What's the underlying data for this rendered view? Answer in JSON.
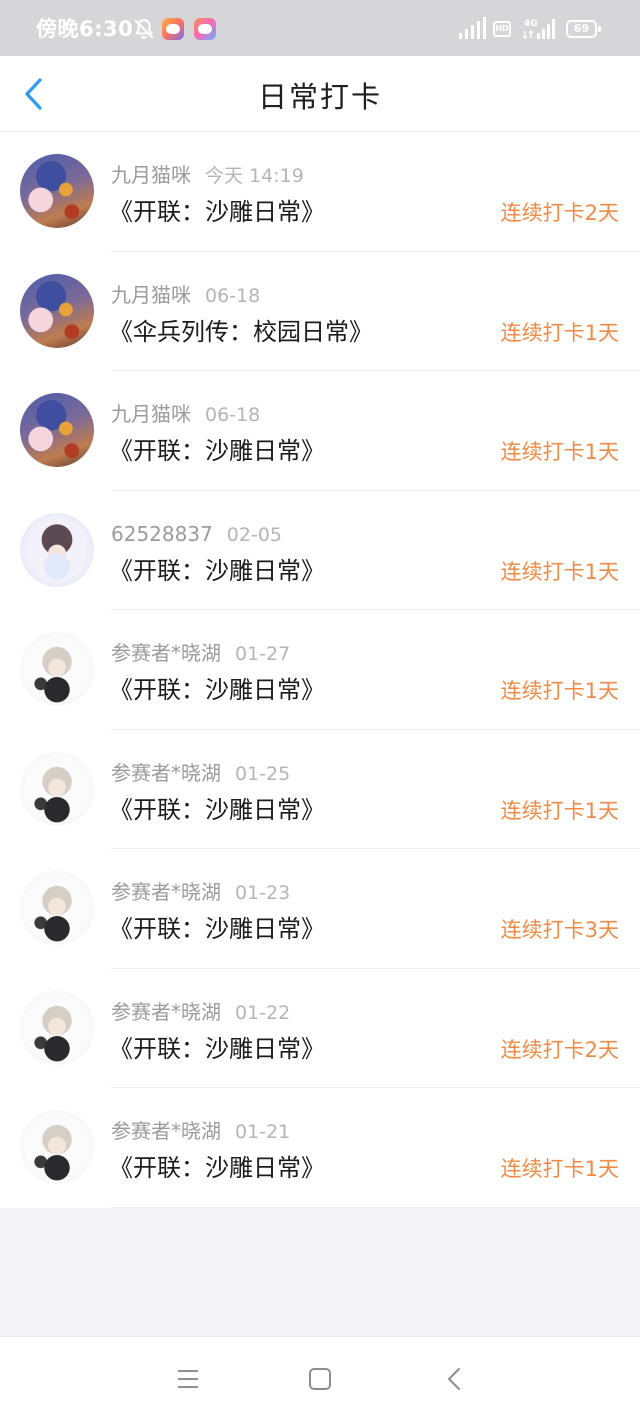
{
  "status_bar": {
    "time": "傍晚6:30",
    "battery": "69",
    "hd_label": "HD",
    "network_label": "4G",
    "icons": [
      "bell-off-icon",
      "game-app-icon",
      "game-app-icon",
      "signal-icon",
      "hd-icon",
      "network-4g-icon",
      "battery-icon"
    ]
  },
  "header": {
    "title": "日常打卡",
    "back_icon": "chevron-left-icon"
  },
  "colors": {
    "accent_blue": "#2b9bf4",
    "streak_orange": "#ef8b46",
    "meta_gray": "#9b9b9d"
  },
  "checkins": [
    {
      "user": "九月猫咪",
      "date": "今天 14:19",
      "title": "《开联：沙雕日常》",
      "streak": "连续打卡2天",
      "avatar": "cat-avatar"
    },
    {
      "user": "九月猫咪",
      "date": "06-18",
      "title": "《伞兵列传：校园日常》",
      "streak": "连续打卡1天",
      "avatar": "cat-avatar"
    },
    {
      "user": "九月猫咪",
      "date": "06-18",
      "title": "《开联：沙雕日常》",
      "streak": "连续打卡1天",
      "avatar": "cat-avatar"
    },
    {
      "user": "62528837",
      "date": "02-05",
      "title": "《开联：沙雕日常》",
      "streak": "连续打卡1天",
      "avatar": "girl-avatar"
    },
    {
      "user": "参赛者*晓湖",
      "date": "01-27",
      "title": "《开联：沙雕日常》",
      "streak": "连续打卡1天",
      "avatar": "chibi-avatar"
    },
    {
      "user": "参赛者*晓湖",
      "date": "01-25",
      "title": "《开联：沙雕日常》",
      "streak": "连续打卡1天",
      "avatar": "chibi-avatar"
    },
    {
      "user": "参赛者*晓湖",
      "date": "01-23",
      "title": "《开联：沙雕日常》",
      "streak": "连续打卡3天",
      "avatar": "chibi-avatar"
    },
    {
      "user": "参赛者*晓湖",
      "date": "01-22",
      "title": "《开联：沙雕日常》",
      "streak": "连续打卡2天",
      "avatar": "chibi-avatar"
    },
    {
      "user": "参赛者*晓湖",
      "date": "01-21",
      "title": "《开联：沙雕日常》",
      "streak": "连续打卡1天",
      "avatar": "chibi-avatar"
    }
  ],
  "nav_bar": {
    "icons": [
      "menu-icon",
      "home-icon",
      "back-icon"
    ]
  }
}
